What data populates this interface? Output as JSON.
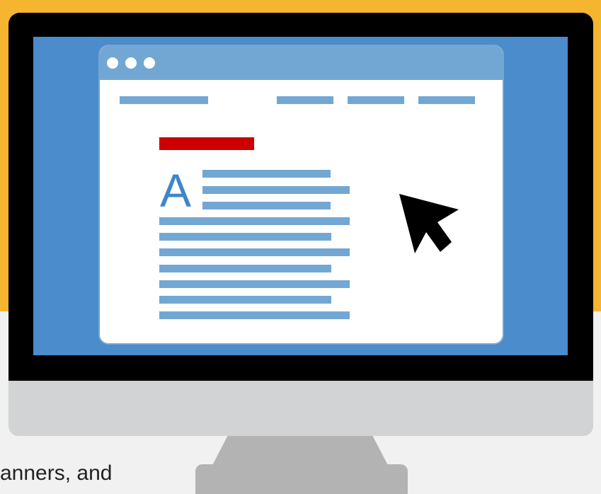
{
  "colors": {
    "background_top": "#f6b52e",
    "background_bottom": "#f0f1f0",
    "bezel": "#000000",
    "screen": "#4a8ccc",
    "window_titlebar": "#73a7d3",
    "placeholder_line": "#73a7d3",
    "headline_bar": "#cc0000",
    "letter": "#3f86c9",
    "chin": "#d1d3d4",
    "stand": "#b3b3b3",
    "cursor": "#000000"
  },
  "icons": {
    "window_controls": [
      "window-dot-icon",
      "window-dot-icon",
      "window-dot-icon"
    ],
    "cursor": "mouse-pointer-icon"
  },
  "article": {
    "drop_cap_letter": "A"
  },
  "caption": {
    "text": "anners, and"
  }
}
